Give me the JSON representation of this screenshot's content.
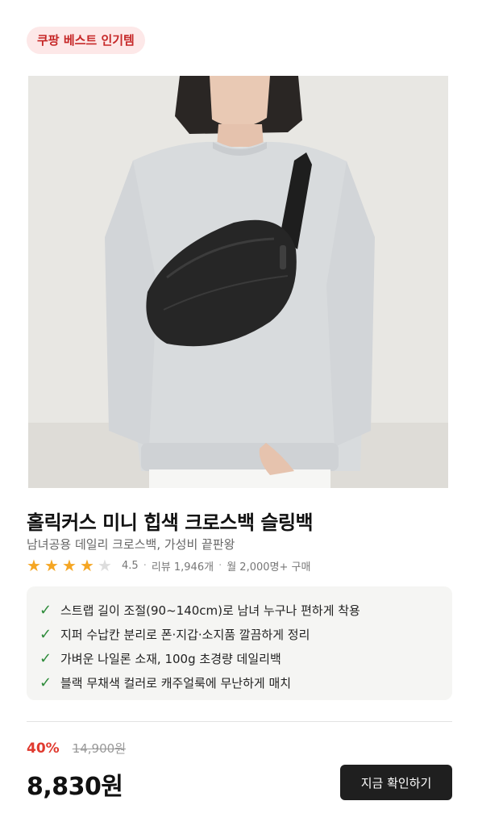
{
  "badge": {
    "label": "쿠팡 베스트 인기템"
  },
  "product": {
    "title": "홀릭커스 미니 힙색 크로스백 슬링백",
    "subtitle": "남녀공용 데일리 크로스백, 가성비 끝판왕",
    "rating": 4.5,
    "stars_filled": 4,
    "stars_total": 5,
    "rating_label": "4.5",
    "reviews_label": "리뷰 1,946개",
    "sales_label": "월 2,000명+ 구매"
  },
  "features": [
    "스트랩 길이 조절(90~140cm)로 남녀 누구나 편하게 착용",
    "지퍼 수납칸 분리로 폰·지갑·소지품 깔끔하게 정리",
    "가벼운 나일론 소재, 100g 초경량 데일리백",
    "블랙 무채색 컬러로 캐주얼룩에 무난하게 매치"
  ],
  "pricing": {
    "discount": "40%",
    "original_price": "14,900원",
    "price": "8,830원"
  },
  "cta": {
    "label": "지금 확인하기"
  },
  "colors": {
    "badge_bg": "#fde8e8",
    "badge_text": "#c62828",
    "star": "#f5a623",
    "check": "#2e8b3a",
    "discount": "#e03a2f",
    "cta_bg": "#1f1f1f"
  }
}
